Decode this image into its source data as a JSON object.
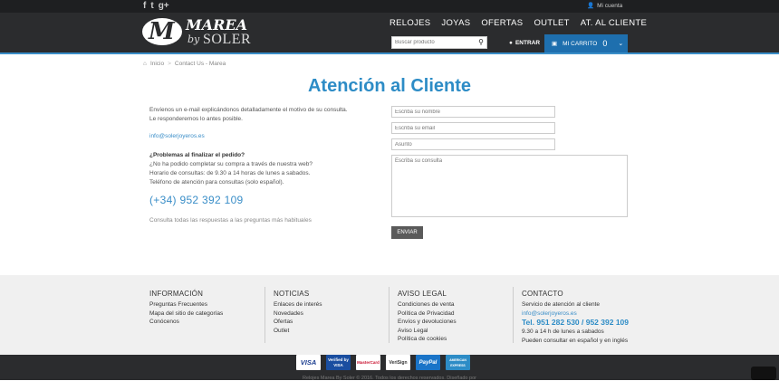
{
  "topbar": {
    "social": [
      "f",
      "t",
      "g+"
    ],
    "account_label": "Mi cuenta"
  },
  "brand": {
    "word": "MAREA",
    "by": "by",
    "company": "SOLER",
    "monogram": "M"
  },
  "nav": {
    "items": [
      "RELOJES",
      "JOYAS",
      "OFERTAS",
      "OUTLET",
      "AT. AL CLIENTE"
    ]
  },
  "search": {
    "placeholder": "Buscar producto"
  },
  "login": {
    "label": "ENTRAR"
  },
  "cart": {
    "label": "MI CARRITO",
    "count": "0"
  },
  "breadcrumb": {
    "home": "Inicio",
    "separator": ">",
    "current": "Contact Us - Marea"
  },
  "page": {
    "title": "Atención al Cliente",
    "intro_line1": "Envíenos un e-mail explicándonos detalladamente el motivo de su consulta.",
    "intro_line2": "Le responderemos lo antes posible.",
    "email": "info@solerjoyeros.es",
    "problems_title": "¿Problemas al finalizar el pedido?",
    "problems_line1": "¿No ha podido completar su compra a través de nuestra web?",
    "problems_line2": "Horario de consultas: de 9.30 a 14 horas de lunes a sabados.",
    "problems_line3": "Teléfono de atención para consultas (solo español).",
    "phone": "(+34) 952 392 109",
    "faq_link": "Consulta todas las respuestas a las preguntas más habituales"
  },
  "form": {
    "name_placeholder": "Escriba su nombre",
    "email_placeholder": "Escriba su email",
    "subject_placeholder": "Asunto",
    "message_placeholder": "Escriba su consulta",
    "submit_label": "ENVIAR"
  },
  "footer": {
    "info": {
      "title": "INFORMACIÓN",
      "items": [
        "Preguntas Frecuentes",
        "Mapa del sitio de categorías",
        "Conócenos"
      ]
    },
    "news": {
      "title": "NOTICIAS",
      "items": [
        "Enlaces de interés",
        "Novedades",
        "Ofertas",
        "Outlet"
      ]
    },
    "legal": {
      "title": "AVISO LEGAL",
      "items": [
        "Condiciones de venta",
        "Política de Privacidad",
        "Envíos y devoluciones",
        "Aviso Legal",
        "Política de cookies"
      ]
    },
    "contact": {
      "title": "CONTACTO",
      "line1": "Servicio de atención al cliente",
      "email": "info@solerjoyeros.es",
      "tel": "Tel. 951 282 530 / 952 392 109",
      "hours": "9.30 a 14 h de lunes a sabados",
      "languages": "Pueden consultar en español y en inglés"
    }
  },
  "payments": [
    "VISA",
    "Verified by VISA",
    "MasterCard",
    "VeriSign",
    "PayPal",
    "AMERICAN EXPRESS"
  ],
  "copyright": "Relojes Marea By Soler © 2016. Todos los derechos reservados. Diseñado por",
  "colors": {
    "accent": "#2d8cc6",
    "header": "#2b2c2e",
    "cart": "#1e6fae"
  }
}
